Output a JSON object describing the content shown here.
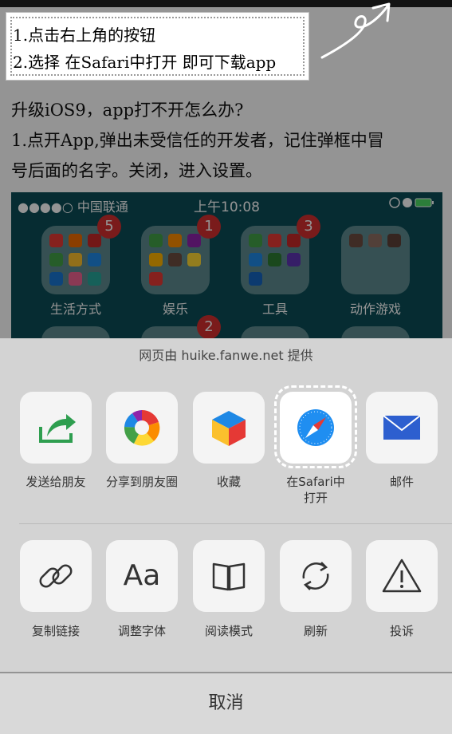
{
  "tip": {
    "line1": "1.点击右上角的按钮",
    "line2": "2.选择 在Safari中打开 即可下载app"
  },
  "article": {
    "heading": "升级iOS9，app打不开怎么办?",
    "line1": "1.点开App,弹出未受信任的开发者，记住弹框中冒",
    "line2": "号后面的名字。关闭，进入设置。"
  },
  "screenshot": {
    "carrier": "●●●●○ 中国联通",
    "time": "上午10:08",
    "folders": [
      {
        "label": "生活方式",
        "badge": "5"
      },
      {
        "label": "娱乐",
        "badge": "1"
      },
      {
        "label": "工具",
        "badge": "3"
      },
      {
        "label": "动作游戏",
        "badge": ""
      }
    ],
    "second_row_badge": "2"
  },
  "sheet": {
    "provider": "网页由 huike.fanwe.net 提供",
    "row1": [
      {
        "label": "发送给朋友",
        "icon": "send-to-friend-icon"
      },
      {
        "label": "分享到朋友圈",
        "icon": "moments-icon"
      },
      {
        "label": "收藏",
        "icon": "favorites-cube-icon"
      },
      {
        "label": "在Safari中\n打开",
        "icon": "safari-compass-icon"
      },
      {
        "label": "邮件",
        "icon": "mail-envelope-icon"
      }
    ],
    "row2": [
      {
        "label": "复制链接",
        "icon": "link-icon"
      },
      {
        "label": "调整字体",
        "icon": "font-aa-icon"
      },
      {
        "label": "阅读模式",
        "icon": "book-icon"
      },
      {
        "label": "刷新",
        "icon": "refresh-icon"
      },
      {
        "label": "投诉",
        "icon": "warning-icon"
      }
    ],
    "cancel": "取消"
  },
  "glyphs": {
    "font_icon": "Aa"
  },
  "colors": {
    "send_icon": "#2e9e4f",
    "safari_blue": "#1f8ef1",
    "mail_blue": "#2d5fcf",
    "badge_red": "#d32f2f"
  }
}
